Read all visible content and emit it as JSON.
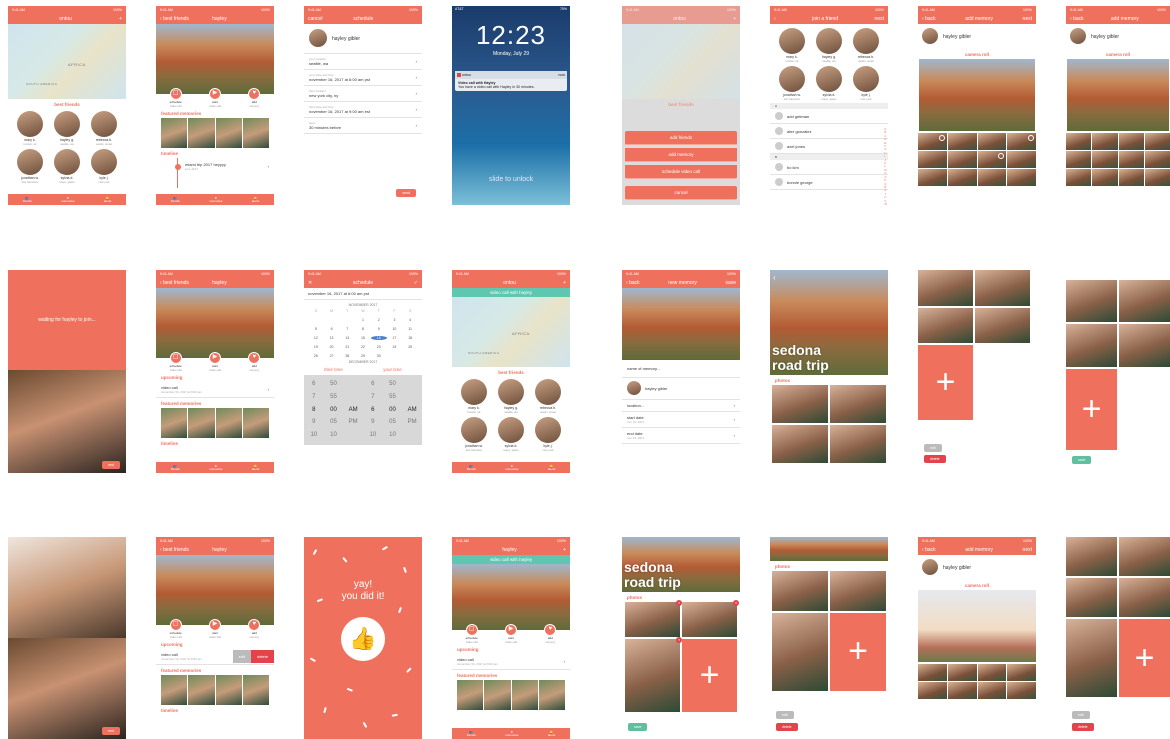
{
  "status": {
    "time": "9:41 AM",
    "battery": "100%"
  },
  "app_title": "ontou",
  "tabs": [
    "friends",
    "memories",
    "alerts"
  ],
  "home": {
    "best_friends_label": "best friends",
    "map_labels": [
      "AFRICA",
      "SOUTH AMERICA"
    ],
    "friends": [
      {
        "name": "mary k.",
        "loc": "london, uk"
      },
      {
        "name": "hayley g.",
        "loc": "seattle, wa"
      },
      {
        "name": "rebecca b.",
        "loc": "austin, texas"
      },
      {
        "name": "jonathan w.",
        "loc": "san francisco"
      },
      {
        "name": "sylvia d.",
        "loc": "tokyo, japan"
      },
      {
        "name": "kyle j.",
        "loc": "new york"
      }
    ]
  },
  "profile": {
    "back": "best friends",
    "name": "hayley",
    "actions": [
      {
        "label": "schedule",
        "sub": "video call"
      },
      {
        "label": "start",
        "sub": "video call"
      },
      {
        "label": "add",
        "sub": "memory"
      }
    ],
    "featured": "featured memories",
    "timeline": "timeline",
    "timeline_item": "miami trip 2017 heyyyy",
    "timeline_date": "june 2017",
    "upcoming": "upcoming",
    "upcoming_item": "video call",
    "upcoming_date": "november 16, 2017 at 8:00 am",
    "edit": "edit",
    "delete": "delete"
  },
  "schedule": {
    "cancel": "cancel",
    "title": "schedule",
    "person": "hayley gibler",
    "rows": [
      {
        "lab": "your location",
        "val": "seattle, wa"
      },
      {
        "lab": "your date and time",
        "val": "november 16, 2017 at 6:00 am pst"
      },
      {
        "lab": "their location",
        "val": "new york city, ny"
      },
      {
        "lab": "their date and time",
        "val": "november 16, 2017 at 9:00 am est"
      },
      {
        "lab": "alert",
        "val": "30 minutes before"
      }
    ],
    "send": "send"
  },
  "lock": {
    "carrier": "AT&T",
    "battery": "75%",
    "time": "12:23",
    "date": "Monday, July 29",
    "app": "ontou",
    "when": "now",
    "notif_title": "Video call with Hayley",
    "notif_body": "You have a video call with Hayley in 30 minutes.",
    "slide": "slide to unlock"
  },
  "sheet": {
    "items": [
      "add friends",
      "add memory",
      "schedule video call"
    ],
    "cancel": "cancel"
  },
  "join": {
    "title": "join a friend",
    "next": "next",
    "letters": [
      "A",
      "B"
    ],
    "contacts": [
      "add gettman",
      "alex gonzalez",
      "axel jones",
      "bo kim",
      "bonnie george"
    ],
    "alpha": [
      "A",
      "B",
      "C",
      "D",
      "E",
      "F",
      "G",
      "H",
      "I",
      "J",
      "K",
      "L",
      "M",
      "N",
      "O",
      "P",
      "Q",
      "R",
      "S",
      "T",
      "U",
      "V",
      "W",
      "X",
      "Y",
      "Z",
      "#"
    ]
  },
  "add_memory": {
    "back": "back",
    "title": "add memory",
    "next": "next",
    "person": "hayley gibler",
    "camera_roll": "camera roll"
  },
  "waiting": {
    "text": "waiting for hayley to join...",
    "end": "end"
  },
  "datepick": {
    "date": "november 16, 2017 at 6:00 am pst",
    "month": "NOVEMBER 2017",
    "month2": "DECEMBER 2017",
    "weekdays": [
      "S",
      "M",
      "T",
      "W",
      "T",
      "F",
      "S"
    ],
    "days": [
      "",
      "",
      "",
      "1",
      "2",
      "3",
      "4",
      "5",
      "6",
      "7",
      "8",
      "9",
      "10",
      "11",
      "12",
      "13",
      "14",
      "15",
      "16",
      "17",
      "18",
      "19",
      "20",
      "21",
      "22",
      "23",
      "24",
      "25",
      "26",
      "27",
      "28",
      "29",
      "30",
      "",
      ""
    ],
    "their": "their time",
    "your": "your time",
    "picker": [
      "6",
      "50",
      "",
      "6",
      "50",
      "",
      "7",
      "55",
      "",
      "7",
      "55",
      "",
      "8",
      "00",
      "AM",
      "6",
      "00",
      "AM",
      "9",
      "05",
      "PM",
      "9",
      "05",
      "PM",
      "10",
      "10",
      "",
      "10",
      "10",
      ""
    ]
  },
  "vc_home": {
    "banner": "video call with hayley"
  },
  "new_memory": {
    "back": "back",
    "title": "new memory",
    "save": "save",
    "name_ph": "name of memory...",
    "person": "hayley gibler",
    "location": "location...",
    "start": "start date",
    "start_val": "nov 15, 2017",
    "end": "end date",
    "end_val": "nov 19, 2017"
  },
  "sedona": {
    "title1": "sedona",
    "title2": "road trip",
    "photos": "photos",
    "edit": "edit",
    "delete": "delete",
    "save": "save"
  },
  "yay": {
    "line1": "yay!",
    "line2": "you did it!"
  }
}
